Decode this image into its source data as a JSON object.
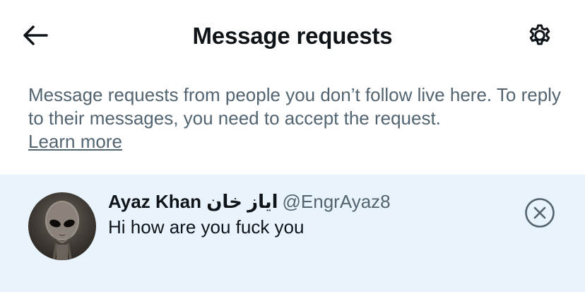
{
  "header": {
    "title": "Message requests",
    "back_icon": "arrow-left-icon",
    "settings_icon": "gear-icon"
  },
  "info": {
    "text": "Message requests from people you don’t follow live here. To reply to their messages, you need to accept the request.",
    "learn_more": "Learn more"
  },
  "requests": [
    {
      "display_name": "Ayaz Khan ایاز خان",
      "handle": "@EngrAyaz8",
      "message": "Hi how are you fuck you",
      "dismiss_icon": "close-circle-icon"
    }
  ],
  "colors": {
    "primary_text": "#0f1419",
    "secondary_text": "#536471",
    "row_highlight": "#e8f3fb",
    "background": "#ffffff"
  }
}
